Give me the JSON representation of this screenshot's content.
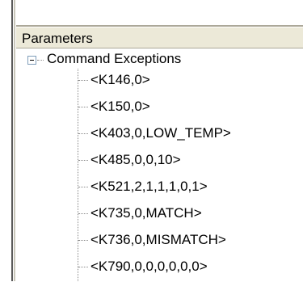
{
  "header": {
    "title": "Parameters"
  },
  "tree": {
    "root": {
      "label": "Command Exceptions",
      "expanded": true
    },
    "items": [
      {
        "label": "<K146,0>"
      },
      {
        "label": "<K150,0>"
      },
      {
        "label": "<K403,0,LOW_TEMP>"
      },
      {
        "label": "<K485,0,0,10>"
      },
      {
        "label": "<K521,2,1,1,1,0,1>"
      },
      {
        "label": "<K735,0,MATCH>"
      },
      {
        "label": "<K736,0,MISMATCH>"
      },
      {
        "label": "<K790,0,0,0,0,0,0>"
      }
    ]
  }
}
